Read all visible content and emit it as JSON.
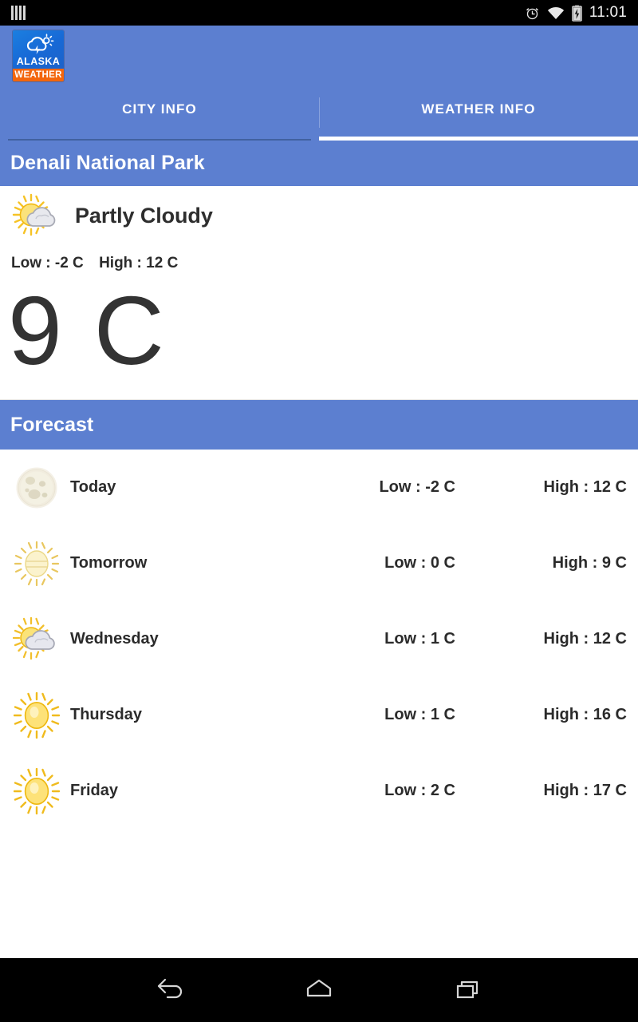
{
  "status_bar": {
    "icons": [
      "sim-bars-icon",
      "alarm-clock-icon",
      "wifi-icon",
      "battery-charging-icon"
    ],
    "time": "11:01"
  },
  "app_bar": {
    "logo": {
      "icon": "cloud-sun-lightning-icon",
      "line1": "ALASKA",
      "line2": "WEATHER",
      "bg_color": "#1769d6",
      "band_color": "#f3660d"
    }
  },
  "tabs": [
    {
      "label": "CITY INFO",
      "active": false,
      "name": "tab-city-info"
    },
    {
      "label": "WEATHER INFO",
      "active": true,
      "name": "tab-weather-info"
    }
  ],
  "city": {
    "name": "Denali National Park"
  },
  "current": {
    "icon": "sun-behind-cloud-icon",
    "condition": "Partly Cloudy",
    "low": "Low : -2 C",
    "high": "High : 12 C",
    "temperature": "9 C"
  },
  "forecast": {
    "title": "Forecast",
    "rows": [
      {
        "icon": "full-moon-icon",
        "day": "Today",
        "low": "Low : -2 C",
        "high": "High : 12 C"
      },
      {
        "icon": "hazy-sun-icon",
        "day": "Tomorrow",
        "low": "Low : 0 C",
        "high": "High : 9 C"
      },
      {
        "icon": "sun-behind-cloud-icon",
        "day": "Wednesday",
        "low": "Low : 1 C",
        "high": "High : 12 C"
      },
      {
        "icon": "sun-icon",
        "day": "Thursday",
        "low": "Low : 1 C",
        "high": "High : 16 C"
      },
      {
        "icon": "sun-icon",
        "day": "Friday",
        "low": "Low : 2 C",
        "high": "High : 17 C"
      }
    ]
  },
  "nav_bar": {
    "buttons": [
      {
        "name": "back-icon",
        "label": "Back"
      },
      {
        "name": "home-icon",
        "label": "Home"
      },
      {
        "name": "recents-icon",
        "label": "Recents"
      }
    ]
  },
  "colors": {
    "primary_blue": "#5c7fd0",
    "accent_orange": "#f3660d",
    "text_dark": "#2b2b2b",
    "status_bar": "#000000"
  }
}
